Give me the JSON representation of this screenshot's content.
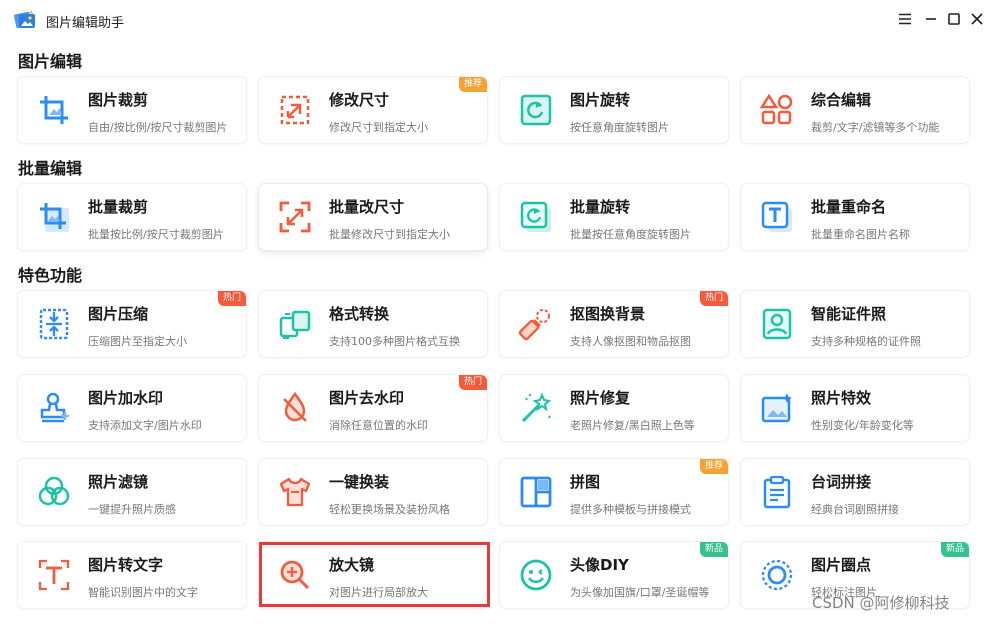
{
  "window": {
    "title": "图片编辑助手",
    "icons": [
      "menu-icon",
      "minimize-icon",
      "maximize-icon",
      "close-icon"
    ]
  },
  "sections": [
    {
      "title": "图片编辑",
      "cards": [
        {
          "title": "图片裁剪",
          "subtitle": "自由/按比例/按尺寸裁剪图片",
          "icon": "crop-icon",
          "badge": ""
        },
        {
          "title": "修改尺寸",
          "subtitle": "修改尺寸到指定大小",
          "icon": "resize-icon",
          "badge": "推荐"
        },
        {
          "title": "图片旋转",
          "subtitle": "按任意角度旋转图片",
          "icon": "rotate-icon",
          "badge": ""
        },
        {
          "title": "综合编辑",
          "subtitle": "裁剪/文字/滤镜等多个功能",
          "icon": "shapes-icon",
          "badge": ""
        }
      ]
    },
    {
      "title": "批量编辑",
      "cards": [
        {
          "title": "批量裁剪",
          "subtitle": "批量按比例/按尺寸裁剪图片",
          "icon": "batch-crop-icon",
          "badge": ""
        },
        {
          "title": "批量改尺寸",
          "subtitle": "批量修改尺寸到指定大小",
          "icon": "batch-resize-icon",
          "badge": ""
        },
        {
          "title": "批量旋转",
          "subtitle": "批量按任意角度旋转图片",
          "icon": "batch-rotate-icon",
          "badge": ""
        },
        {
          "title": "批量重命名",
          "subtitle": "批量重命名图片名称",
          "icon": "batch-rename-icon",
          "badge": ""
        }
      ]
    },
    {
      "title": "特色功能",
      "cards": [
        {
          "title": "图片压缩",
          "subtitle": "压缩图片至指定大小",
          "icon": "compress-icon",
          "badge": "热门"
        },
        {
          "title": "格式转换",
          "subtitle": "支持100多种图片格式互换",
          "icon": "format-convert-icon",
          "badge": ""
        },
        {
          "title": "抠图换背景",
          "subtitle": "支持人像抠图和物品抠图",
          "icon": "eraser-icon",
          "badge": "热门"
        },
        {
          "title": "智能证件照",
          "subtitle": "支持多种规格的证件照",
          "icon": "id-photo-icon",
          "badge": ""
        },
        {
          "title": "图片加水印",
          "subtitle": "支持添加文字/图片水印",
          "icon": "stamp-icon",
          "badge": ""
        },
        {
          "title": "图片去水印",
          "subtitle": "消除任意位置的水印",
          "icon": "no-drop-icon",
          "badge": "热门"
        },
        {
          "title": "照片修复",
          "subtitle": "老照片修复/黑白照上色等",
          "icon": "magic-wand-icon",
          "badge": ""
        },
        {
          "title": "照片特效",
          "subtitle": "性别变化/年龄变化等",
          "icon": "image-sparkle-icon",
          "badge": ""
        },
        {
          "title": "照片滤镜",
          "subtitle": "一键提升照片质感",
          "icon": "filter-circles-icon",
          "badge": ""
        },
        {
          "title": "一键换装",
          "subtitle": "轻松更换场景及装扮风格",
          "icon": "tshirt-icon",
          "badge": ""
        },
        {
          "title": "拼图",
          "subtitle": "提供多种模板与拼接模式",
          "icon": "collage-icon",
          "badge": "推荐"
        },
        {
          "title": "台词拼接",
          "subtitle": "经典台词剧照拼接",
          "icon": "clipboard-icon",
          "badge": ""
        },
        {
          "title": "图片转文字",
          "subtitle": "智能识别图片中的文字",
          "icon": "text-recognize-icon",
          "badge": ""
        },
        {
          "title": "放大镜",
          "subtitle": "对图片进行局部放大",
          "icon": "zoom-in-icon",
          "badge": ""
        },
        {
          "title": "头像DIY",
          "subtitle": "为头像加国旗/口罩/圣诞帽等",
          "icon": "smiley-icon",
          "badge": "新品"
        },
        {
          "title": "图片圈点",
          "subtitle": "轻松标注图片",
          "icon": "circle-mark-icon",
          "badge": "新品"
        }
      ]
    }
  ],
  "watermark": "CSDN @阿修柳科技",
  "colors": {
    "orange": "#f5a233",
    "red": "#f45a3c",
    "green": "#35c28c",
    "blue": "#2d8cf0",
    "teal": "#1cc3a8",
    "highlight": "#e83a3a"
  }
}
